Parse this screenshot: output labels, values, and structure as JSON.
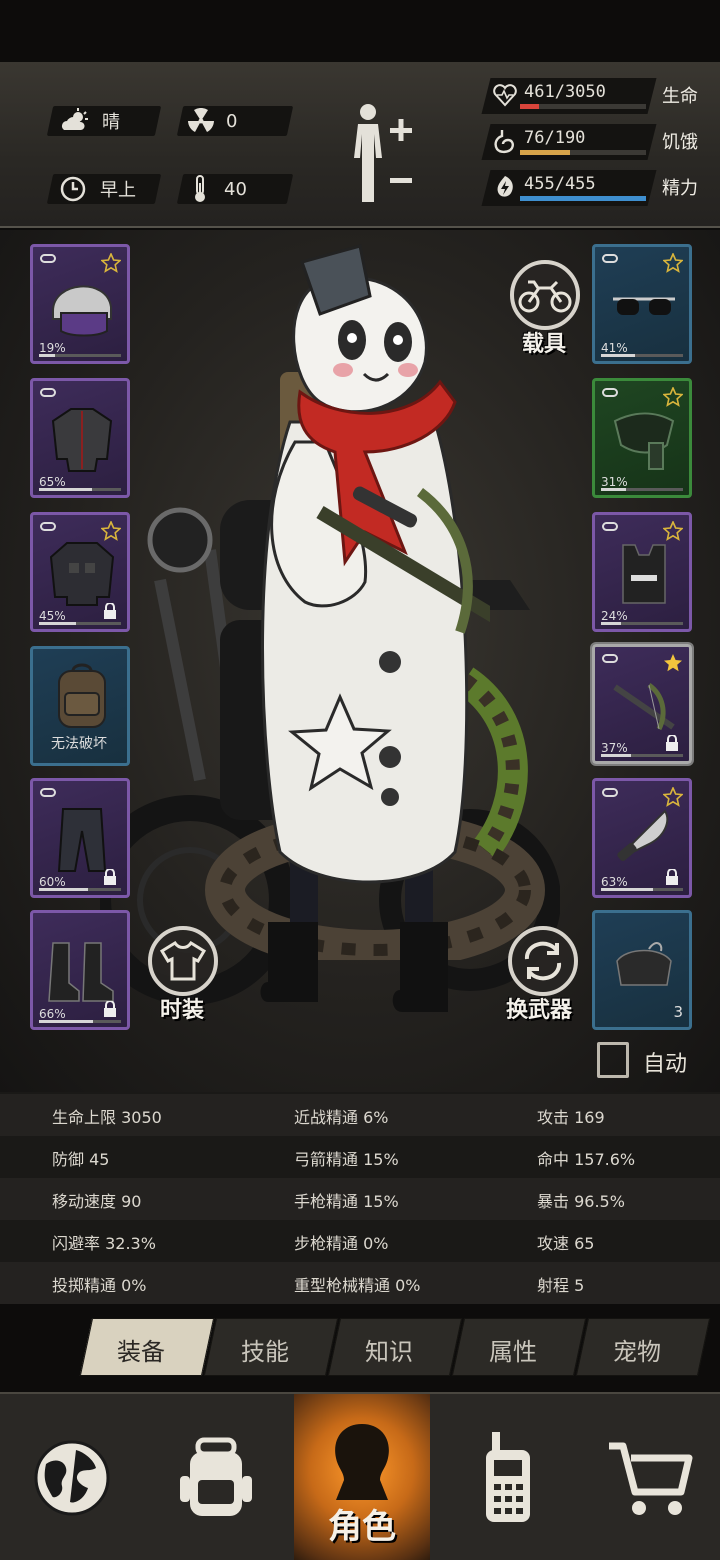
{
  "hud": {
    "weather": {
      "icon": "cloud-sun-icon",
      "label": "晴"
    },
    "radiation": {
      "icon": "radiation-icon",
      "value": "0"
    },
    "time": {
      "icon": "clock-icon",
      "label": "早上"
    },
    "temperature": {
      "icon": "thermometer-icon",
      "value": "40"
    },
    "body_status_icon": "body-plus-minus-icon",
    "vitals": [
      {
        "name": "生命",
        "value": "461/3050",
        "fraction": 0.151,
        "color": "#d9443b",
        "icon": "heart-icon"
      },
      {
        "name": "饥饿",
        "value": "76/190",
        "fraction": 0.4,
        "color": "#d9a54a",
        "icon": "stomach-icon"
      },
      {
        "name": "精力",
        "value": "455/455",
        "fraction": 1.0,
        "color": "#3f8fcf",
        "icon": "energy-icon"
      }
    ]
  },
  "equipment": {
    "left": [
      {
        "name": "police-helmet",
        "durability": "19%",
        "fraction": 0.19,
        "rarity": "purple",
        "starred": true,
        "locked": false
      },
      {
        "name": "jacket",
        "durability": "65%",
        "fraction": 0.65,
        "rarity": "purple",
        "starred": false,
        "locked": false
      },
      {
        "name": "armored-jacket",
        "durability": "45%",
        "fraction": 0.45,
        "rarity": "purple",
        "starred": true,
        "locked": true
      },
      {
        "name": "backpack",
        "durability": "无法破坏",
        "rarity": "blue",
        "starred": false,
        "locked": false
      },
      {
        "name": "pants",
        "durability": "60%",
        "fraction": 0.6,
        "rarity": "purple",
        "starred": false,
        "locked": true
      },
      {
        "name": "boots",
        "durability": "66%",
        "fraction": 0.66,
        "rarity": "purple",
        "starred": false,
        "locked": true
      }
    ],
    "right": [
      {
        "name": "sunglasses",
        "durability": "41%",
        "fraction": 0.41,
        "rarity": "blue",
        "starred": true,
        "locked": false
      },
      {
        "name": "gas-mask",
        "durability": "31%",
        "fraction": 0.31,
        "rarity": "green",
        "starred": true,
        "locked": false
      },
      {
        "name": "police-vest",
        "durability": "24%",
        "fraction": 0.24,
        "rarity": "purple",
        "starred": true,
        "locked": false
      },
      {
        "name": "crossbow",
        "durability": "37%",
        "fraction": 0.37,
        "rarity": "purple",
        "starred": true,
        "locked": true,
        "selected": true
      },
      {
        "name": "machete",
        "durability": "63%",
        "fraction": 0.63,
        "rarity": "purple",
        "starred": true,
        "locked": true
      },
      {
        "name": "bolt-pouch",
        "count": "3",
        "rarity": "blue"
      }
    ]
  },
  "buttons": {
    "vehicle": "载具",
    "outfit": "时装",
    "switch_weapon": "换武器",
    "auto": "自动"
  },
  "stats": [
    [
      "生命上限 3050",
      "近战精通 6%",
      "攻击 169"
    ],
    [
      "防御 45",
      "弓箭精通 15%",
      "命中 157.6%"
    ],
    [
      "移动速度 90",
      "手枪精通 15%",
      "暴击 96.5%"
    ],
    [
      "闪避率 32.3%",
      "步枪精通 0%",
      "攻速 65"
    ],
    [
      "投掷精通 0%",
      "重型枪械精通 0%",
      "射程 5"
    ]
  ],
  "tabs": [
    "装备",
    "技能",
    "知识",
    "属性",
    "宠物"
  ],
  "active_tab": 0,
  "nav": [
    {
      "icon": "globe-icon",
      "label": ""
    },
    {
      "icon": "backpack-icon",
      "label": ""
    },
    {
      "icon": "character-icon",
      "label": "角色"
    },
    {
      "icon": "radio-icon",
      "label": ""
    },
    {
      "icon": "cart-icon",
      "label": ""
    }
  ]
}
